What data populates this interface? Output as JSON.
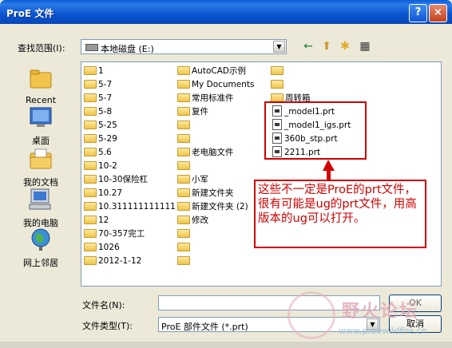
{
  "window": {
    "title": "ProE 文件",
    "help": "?",
    "close": "×"
  },
  "look_in": {
    "label": "查找范围(I):",
    "value": "本地磁盘 (E:)"
  },
  "toolbar": {
    "back": "←",
    "up": "⬆",
    "new_folder": "✱",
    "view": "▦"
  },
  "places": [
    {
      "name": "recent",
      "label": "Recent"
    },
    {
      "name": "desktop",
      "label": "桌面"
    },
    {
      "name": "my-documents",
      "label": "我的文档"
    },
    {
      "name": "my-computer",
      "label": "我的电脑"
    },
    {
      "name": "network",
      "label": "网上邻居"
    }
  ],
  "files": {
    "col1": [
      "1",
      "5-7",
      "5-7",
      "5-8",
      "5-25",
      "5-29",
      "5.6",
      "10-2",
      "10-30保险杠",
      "10.27",
      "10.311111111111",
      "12",
      "70-357完工",
      "1026",
      "2012-1-12"
    ],
    "col2": [
      "AutoCAD示例",
      "My Documents",
      "常用标准件",
      "复件",
      "",
      "",
      "老电脑文件",
      "",
      "小军",
      "新建文件夹",
      "新建文件夹 (2)",
      "修改",
      "",
      "",
      ""
    ],
    "col3_folders": [
      "",
      "",
      "周转箱"
    ],
    "col3_files": [
      "_model1.prt",
      "_model1_igs.prt",
      "360b_stp.prt",
      "2211.prt"
    ]
  },
  "annotation": "这些不一定是ProE的prt文件，很有可能是ug的prt文件，用高版本的ug可以打开。",
  "filename": {
    "label": "文件名(N):",
    "value": ""
  },
  "filetype": {
    "label": "文件类型(T):",
    "value": "ProE 部件文件 (*.prt)"
  },
  "buttons": {
    "ok": "OK",
    "cancel": "取消"
  },
  "watermark": {
    "text": "野火论坛",
    "url": "www.proewildfire.cn"
  }
}
